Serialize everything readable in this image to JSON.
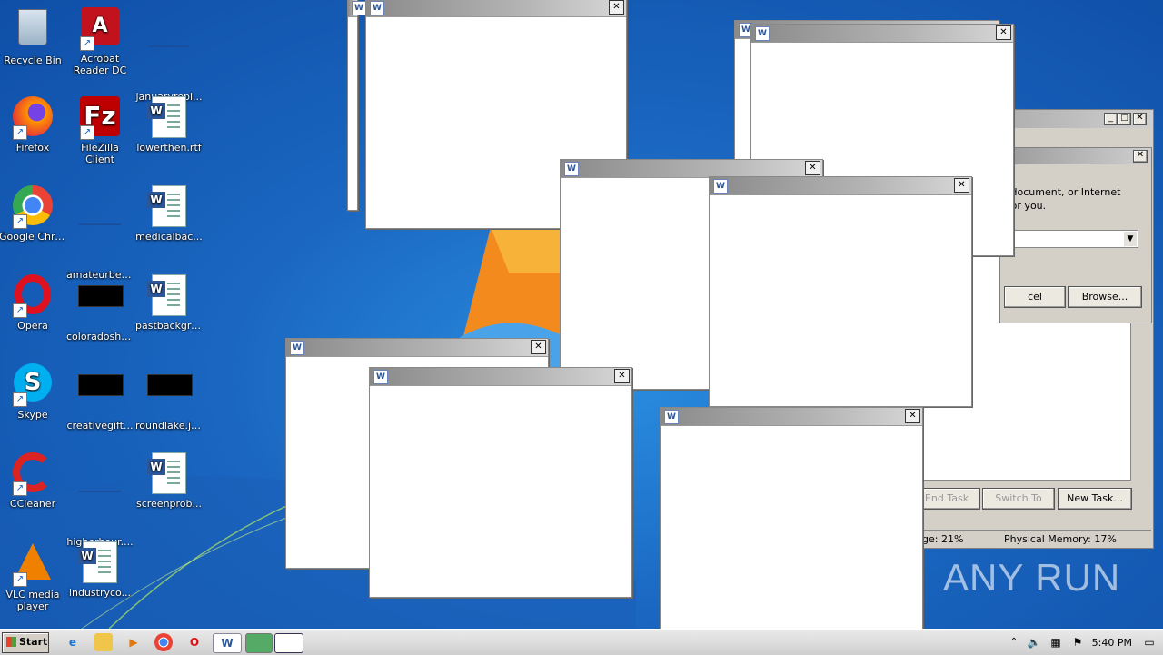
{
  "desktop_icons": [
    {
      "label": "Recycle Bin",
      "icon": "recycle-bin-icon"
    },
    {
      "label": "Acrobat Reader DC",
      "icon": "acrobat-icon"
    },
    {
      "label": "januaryrepl...",
      "icon": "file-icon"
    },
    {
      "label": "Firefox",
      "icon": "firefox-icon"
    },
    {
      "label": "FileZilla Client",
      "icon": "filezilla-icon"
    },
    {
      "label": "lowerthen.rtf",
      "icon": "word-doc-icon"
    },
    {
      "label": "Google Chrome",
      "icon": "chrome-icon"
    },
    {
      "label": "amateurbey...",
      "icon": "file-icon"
    },
    {
      "label": "medicalbac...",
      "icon": "word-doc-icon"
    },
    {
      "label": "Opera",
      "icon": "opera-icon"
    },
    {
      "label": "coloradoshe...",
      "icon": "image-icon"
    },
    {
      "label": "pastbackgro...",
      "icon": "word-doc-icon"
    },
    {
      "label": "Skype",
      "icon": "skype-icon"
    },
    {
      "label": "creativegift...",
      "icon": "image-icon"
    },
    {
      "label": "roundlake.jpg",
      "icon": "image-icon"
    },
    {
      "label": "CCleaner",
      "icon": "ccleaner-icon"
    },
    {
      "label": "higherhour....",
      "icon": "file-icon"
    },
    {
      "label": "screenprob...",
      "icon": "word-doc-icon"
    },
    {
      "label": "VLC media player",
      "icon": "vlc-icon"
    },
    {
      "label": "industryco...",
      "icon": "word-doc-icon"
    }
  ],
  "run_dialog": {
    "text_line1": "r, document, or Internet",
    "text_line2": "t for you.",
    "cancel_label": "cel",
    "browse_label": "Browse..."
  },
  "task_manager": {
    "end_task_label": "End Task",
    "switch_to_label": "Switch To",
    "new_task_label": "New Task...",
    "cpu_usage": "ge: 21%",
    "physical_memory": "Physical Memory: 17%"
  },
  "taskbar": {
    "start_label": "Start",
    "clock": "5:40 PM"
  },
  "watermark": "ANY RUN",
  "colors": {
    "desktop": "#1d6fc5",
    "taskbar": "#d8d8d8",
    "window_title": "#a0a0a0"
  }
}
